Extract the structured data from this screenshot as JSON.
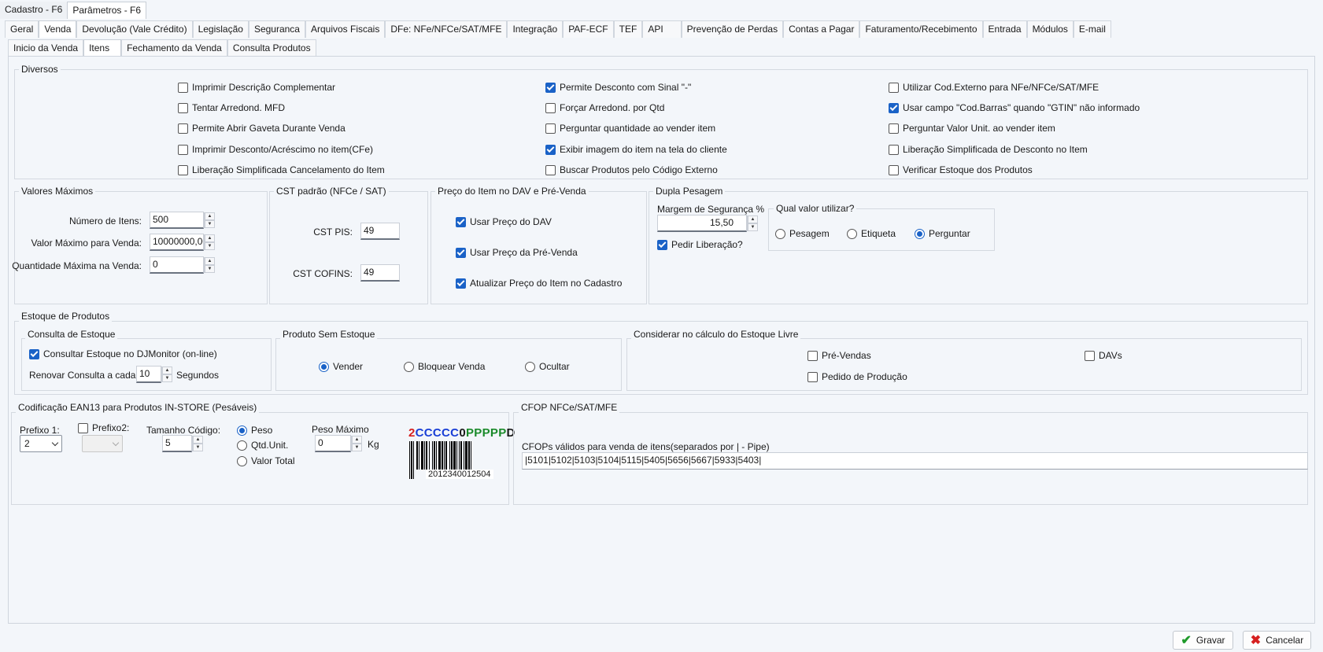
{
  "window_tabs": [
    "Cadastro - F6",
    "Parâmetros - F6"
  ],
  "main_tabs": [
    "Geral",
    "Venda",
    "Devolução (Vale Crédito)",
    "Legislação",
    "Seguranca",
    "Arquivos Fiscais",
    "DFe: NFe/NFCe/SAT/MFE",
    "Integração",
    "PAF-ECF",
    "TEF",
    "API",
    "Prevenção de Perdas",
    "Contas a Pagar",
    "Faturamento/Recebimento",
    "Entrada",
    "Módulos",
    "E-mail"
  ],
  "sub_tabs": [
    "Inicio da Venda",
    "Itens",
    "Fechamento da Venda",
    "Consulta Produtos"
  ],
  "diversos": {
    "title": "Diversos",
    "items": [
      {
        "label": "Imprimir Descrição Complementar",
        "checked": false
      },
      {
        "label": "Tentar Arredond. MFD",
        "checked": false
      },
      {
        "label": "Permite Abrir Gaveta Durante Venda",
        "checked": false
      },
      {
        "label": "Imprimir Desconto/Acréscimo no item(CFe)",
        "checked": false
      },
      {
        "label": "Liberação Simplificada Cancelamento do Item",
        "checked": false
      },
      {
        "label": "Permite Desconto com Sinal \"-\"",
        "checked": true
      },
      {
        "label": "Forçar Arredond. por Qtd",
        "checked": false
      },
      {
        "label": "Perguntar quantidade ao vender item",
        "checked": false
      },
      {
        "label": "Exibir imagem do item na tela do cliente",
        "checked": true
      },
      {
        "label": "Buscar Produtos pelo Código Externo",
        "checked": false
      },
      {
        "label": "Utilizar Cod.Externo para NFe/NFCe/SAT/MFE",
        "checked": false
      },
      {
        "label": "Usar campo \"Cod.Barras\" quando \"GTIN\" não informado",
        "checked": true
      },
      {
        "label": "Perguntar Valor Unit. ao vender item",
        "checked": false
      },
      {
        "label": "Liberação Simplificada de Desconto no Item",
        "checked": false
      },
      {
        "label": "Verificar Estoque dos Produtos",
        "checked": false
      }
    ]
  },
  "valores_maximos": {
    "title": "Valores Máximos",
    "numero_itens_label": "Número de Itens:",
    "numero_itens": "500",
    "valor_maximo_label": "Valor Máximo para Venda:",
    "valor_maximo": "10000000,00",
    "qtd_maxima_label": "Quantidade Máxima na Venda:",
    "qtd_maxima": "0"
  },
  "cst": {
    "title": "CST padrão (NFCe / SAT)",
    "pis_label": "CST PIS:",
    "pis": "49",
    "cofins_label": "CST COFINS:",
    "cofins": "49"
  },
  "preco_dav": {
    "title": "Preço do Item no DAV e Pré-Venda",
    "usar_dav": "Usar Preço do DAV",
    "usar_prevenda": "Usar Preço da Pré-Venda",
    "atualizar": "Atualizar Preço do Item no Cadastro"
  },
  "dupla_pesagem": {
    "title": "Dupla Pesagem",
    "margem_label": "Margem de Segurança %",
    "margem": "15,50",
    "pedir_liberacao": "Pedir Liberação?",
    "qual_title": "Qual valor utilizar?",
    "options": [
      "Pesagem",
      "Etiqueta",
      "Perguntar"
    ],
    "selected": "Perguntar"
  },
  "estoque": {
    "title": "Estoque de Produtos",
    "consulta_title": "Consulta de Estoque",
    "consultar_label": "Consultar Estoque no DJMonitor (on-line)",
    "renovar_label": "Renovar Consulta a cada:",
    "renovar": "10",
    "segundos": "Segundos",
    "sem_estoque_title": "Produto Sem Estoque",
    "sem_estoque_options": [
      "Vender",
      "Bloquear Venda",
      "Ocultar"
    ],
    "sem_estoque_selected": "Vender",
    "livre_title": "Considerar no cálculo do Estoque Livre",
    "pre_vendas": "Pré-Vendas",
    "davs": "DAVs",
    "pedido_producao": "Pedido de Produção"
  },
  "ean13": {
    "title": "Codificação EAN13 para Produtos IN-STORE (Pesáveis)",
    "prefixo1_label": "Prefixo 1:",
    "prefixo1": "2",
    "prefixo2_label": "Prefixo2:",
    "tamanho_label": "Tamanho Código:",
    "tamanho": "5",
    "tipo_options": [
      "Peso",
      "Qtd.Unit.",
      "Valor Total"
    ],
    "tipo_selected": "Peso",
    "peso_max_label": "Peso Máximo",
    "peso_max": "0",
    "kg": "Kg",
    "barcode_parts": [
      "2",
      "CCCCC",
      "0",
      "PPPPP",
      "D"
    ],
    "barcode_number": "2012340012504"
  },
  "cfop": {
    "title": "CFOP NFCe/SAT/MFE",
    "label": "CFOPs válidos para venda de itens(separados por | - Pipe)",
    "value": "|5101|5102|5103|5104|5115|5405|5656|5667|5933|5403|"
  },
  "buttons": {
    "gravar": "Gravar",
    "cancelar": "Cancelar"
  },
  "colors": {
    "accent": "#1a62c7",
    "barcode_prefix": "#d62020",
    "barcode_c": "#1a3fd6",
    "barcode_p": "#1a8a2a"
  }
}
